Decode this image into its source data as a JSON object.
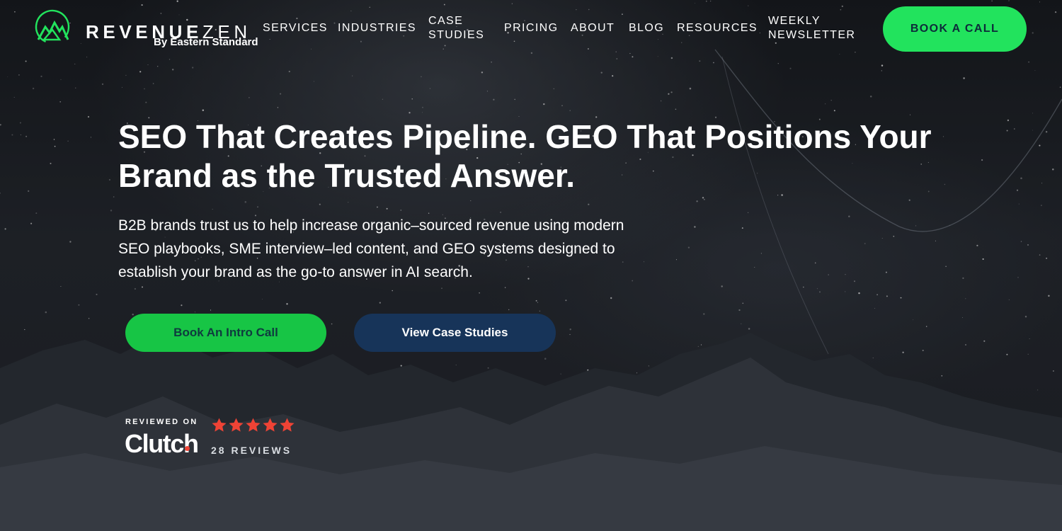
{
  "brand": {
    "word_left": "REVENUE",
    "word_right": "ZEN",
    "tagline": "By Eastern Standard",
    "logo_icon": "mountain-peaks-icon",
    "accent": "#22e35d"
  },
  "nav": {
    "items": [
      {
        "label": "SERVICES"
      },
      {
        "label": "INDUSTRIES"
      },
      {
        "label": "CASE STUDIES"
      },
      {
        "label": "PRICING"
      },
      {
        "label": "ABOUT"
      },
      {
        "label": "BLOG"
      },
      {
        "label": "RESOURCES"
      },
      {
        "label": "WEEKLY NEWSLETTER"
      }
    ],
    "cta_label": "BOOK A CALL"
  },
  "hero": {
    "title": "SEO That Creates Pipeline. GEO That Positions Your Brand as the Trusted Answer.",
    "subtitle": "B2B brands trust us to help increase organic–sourced revenue using modern SEO playbooks, SME interview–led content, and GEO systems designed to establish your brand as the go-to answer in AI search.",
    "primary_button": "Book An Intro Call",
    "secondary_button": "View Case Studies",
    "primary_color": "#17c545",
    "secondary_color": "#173459"
  },
  "clutch": {
    "reviewed_on": "REVIEWED ON",
    "brand": "Clutch",
    "rating": 5,
    "rating_max": 5,
    "star_color": "#ef4335",
    "reviews_label": "28 REVIEWS"
  }
}
